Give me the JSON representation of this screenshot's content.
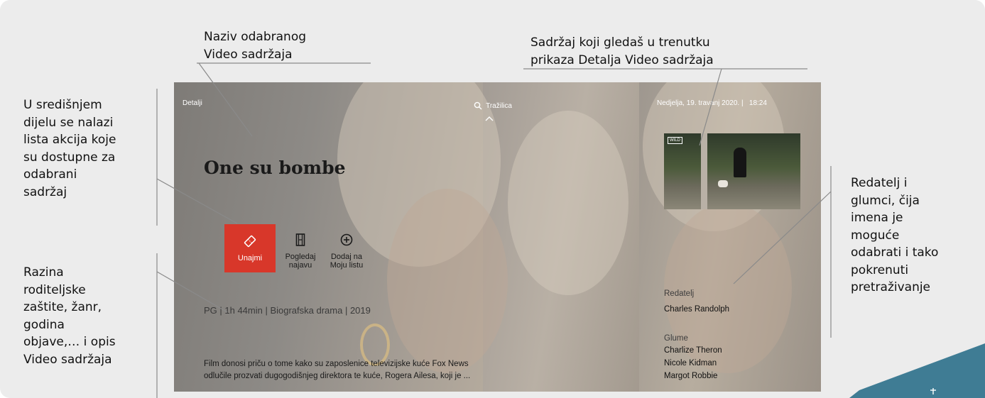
{
  "callouts": {
    "title_note": [
      "Naziv odabranog",
      "Video sadržaja"
    ],
    "now_playing_note": [
      "Sadržaj koji gledaš u trenutku",
      "prikaza Detalja Video sadržaja"
    ],
    "actions_note": [
      "U središnjem",
      "dijelu se nalazi",
      "lista akcija koje",
      "su dostupne za",
      "odabrani",
      "sadržaj"
    ],
    "info_note": [
      "Razina",
      "roditeljske",
      "zaštite, žanr,",
      "godina",
      "objave,… i opis",
      "Video sadržaja"
    ],
    "cast_note": [
      "Redatelj i",
      "glumci, čija",
      "imena je",
      "moguće",
      "odabrati i tako",
      "pokrenuti",
      "pretraživanje"
    ]
  },
  "screen": {
    "section": "Detalji",
    "search_label": "Tražilica",
    "datetime": "Nedjelja, 19. travanj 2020. |   18:24",
    "title": "One su bombe",
    "actions": [
      {
        "label": "Unajmi",
        "icon": "ticket-icon"
      },
      {
        "label_lines": [
          "Pogledaj",
          "najavu"
        ],
        "icon": "film-strip-icon"
      },
      {
        "label_lines": [
          "Dodaj na",
          "Moju listu"
        ],
        "icon": "plus-circle-icon"
      }
    ],
    "meta": "PG | 1h 44min | Biografska drama | 2019",
    "description": [
      "Film donosi priču o tome kako su zaposlenice televizijske kuće Fox News",
      "odlučile prozvati dugogodišnjeg direktora te kuće, Rogera Ailesa, koji je ..."
    ],
    "director_label": "Redatelj",
    "director": "Charles Randolph",
    "cast_label": "Glume",
    "cast": [
      "Charlize Theron",
      "Nicole Kidman",
      "Margot Robbie"
    ],
    "pip_logo": "WILD"
  },
  "colors": {
    "accent": "#d8372a",
    "corner": "#3f7c94"
  }
}
